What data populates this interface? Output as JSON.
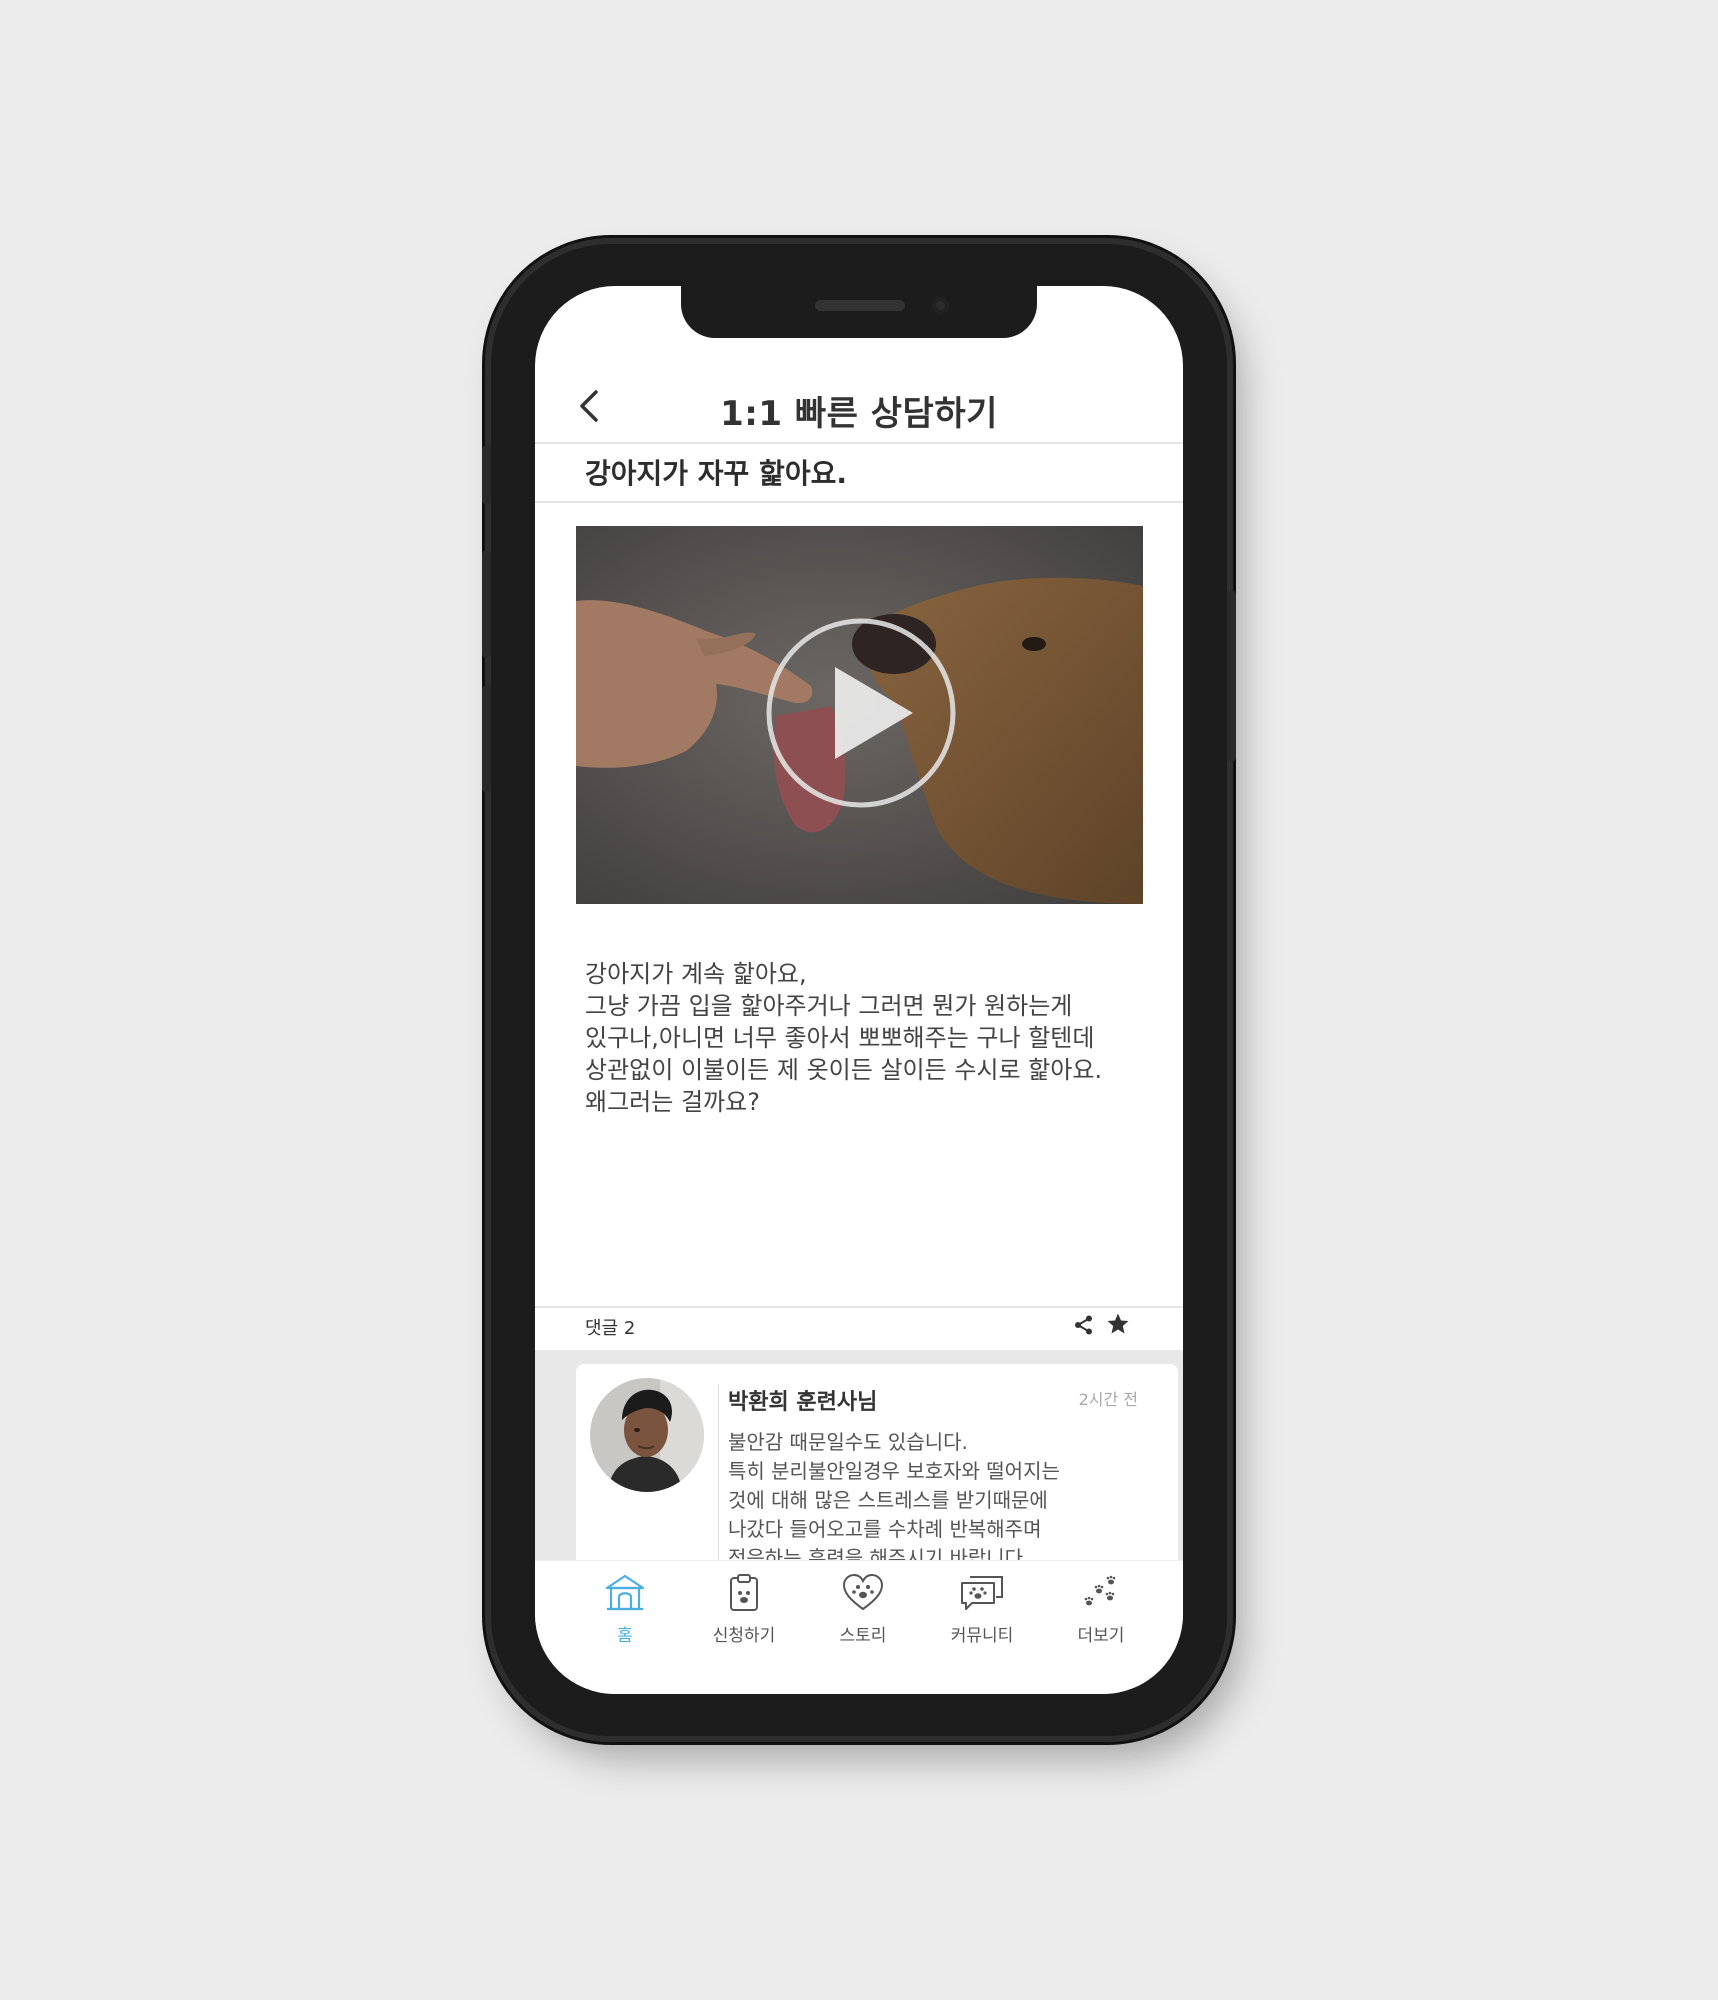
{
  "app": {
    "title": "1:1 빠른 상담하기"
  },
  "post": {
    "title": "강아지가 자꾸 핥아요.",
    "body": "강아지가 계속 핥아요,\n그냥 가끔 입을 핥아주거나 그러면 뭔가 원하는게\n있구나,아니면 너무 좋아서 뽀뽀해주는 구나 할텐데\n상관없이 이불이든 제 옷이든 살이든 수시로 핥아요.\n왜그러는 걸까요?"
  },
  "comments_bar": {
    "count_label": "댓글 2"
  },
  "comments": [
    {
      "author": "박환희 훈련사님",
      "time": "2시간 전",
      "text": "불안감 때문일수도 있습니다.\n특히 분리불안일경우 보호자와 떨어지는\n것에 대해 많은 스트레스를 받기때문에\n나갔다 들어오고를 수차례 반복해주며\n적응하는 훈련을 해주시기 바랍니다."
    }
  ],
  "nav": {
    "items": [
      {
        "label": "홈",
        "icon": "home-icon",
        "active": true
      },
      {
        "label": "신청하기",
        "icon": "clipboard-icon",
        "active": false
      },
      {
        "label": "스토리",
        "icon": "heart-paw-icon",
        "active": false
      },
      {
        "label": "커뮤니티",
        "icon": "chat-paw-icon",
        "active": false
      },
      {
        "label": "더보기",
        "icon": "paws-icon",
        "active": false
      }
    ]
  },
  "colors": {
    "accent": "#4aaee0",
    "text_primary": "#333333",
    "comment_background": "#e8e8e8"
  }
}
